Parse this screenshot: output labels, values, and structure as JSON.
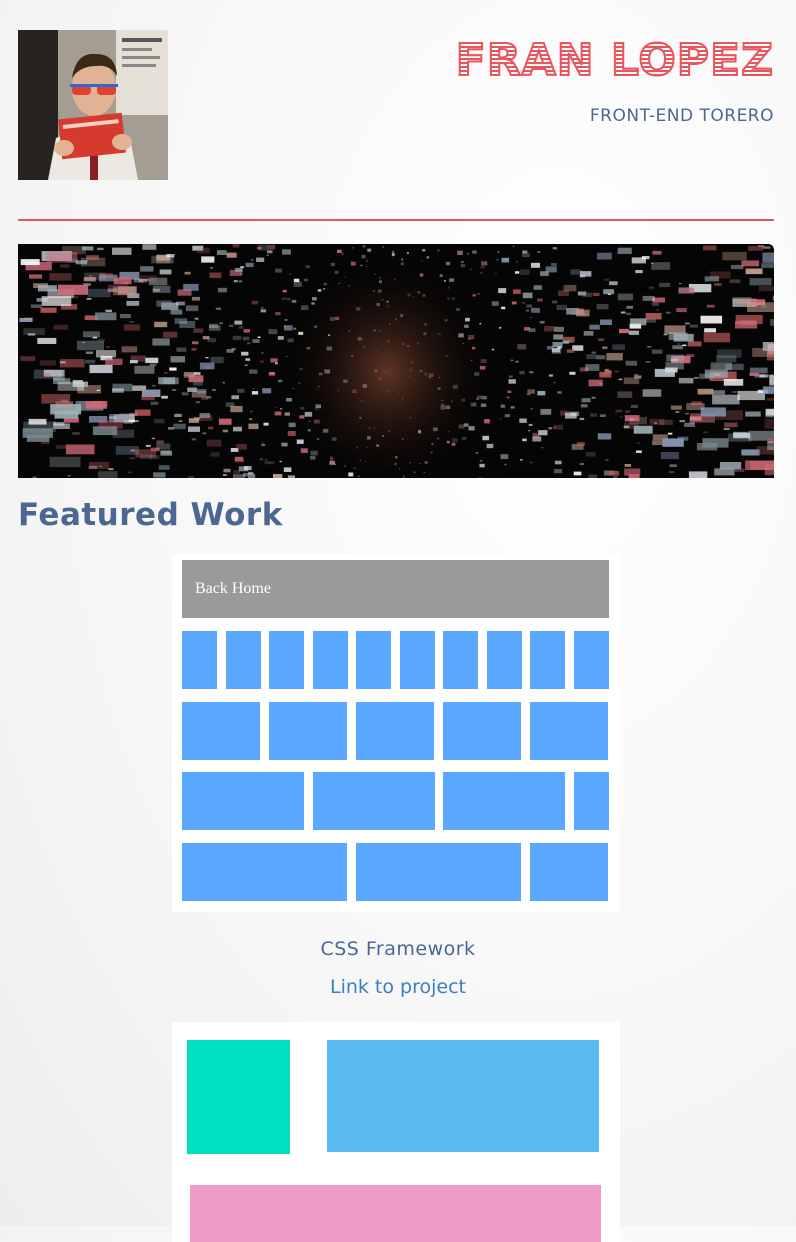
{
  "header": {
    "name": "FRAN LOPEZ",
    "tagline": "FRONT-END TORERO",
    "accent_color": "#e9555d",
    "text_color": "#4a6892"
  },
  "avatar": {
    "icon": "profile-photo"
  },
  "hero": {
    "icon": "pixel-dispersion-banner"
  },
  "featured": {
    "title": "Featured Work",
    "projects": [
      {
        "preview": {
          "nav_label": "Back Home",
          "grid_color": "#5aa8ff"
        },
        "title": "CSS Framework",
        "link_label": "Link to project"
      },
      {
        "preview": {
          "colors": [
            "#00dfbf",
            "#5bbaf0",
            "#ee9bc8"
          ]
        }
      }
    ]
  }
}
